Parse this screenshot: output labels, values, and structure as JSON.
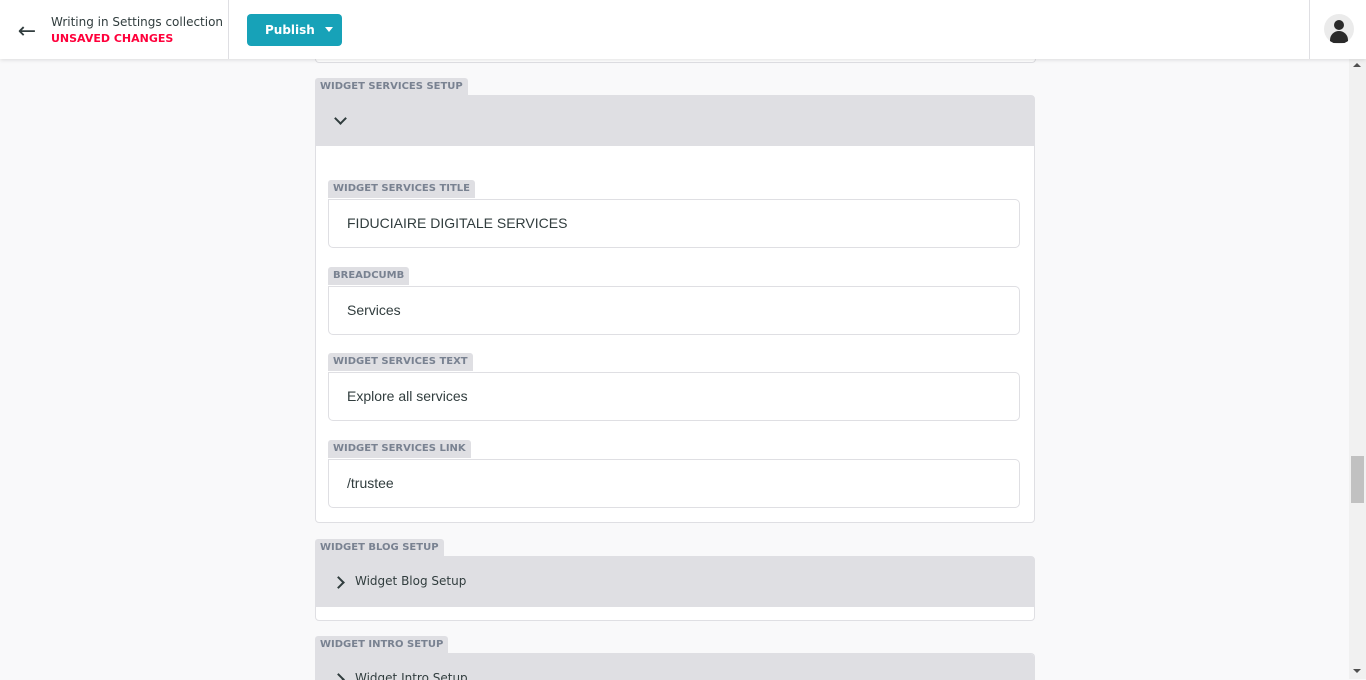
{
  "header": {
    "back_icon": "arrow-left-icon",
    "collection_title": "Writing in Settings collection",
    "status": "UNSAVED CHANGES",
    "publish_label": "Publish",
    "avatar_icon": "user-avatar-icon",
    "colors": {
      "accent": "#17a2b8",
      "unsaved": "#ff003b"
    }
  },
  "widget_services": {
    "label": "WIDGET SERVICES SETUP",
    "expanded": true,
    "fields": [
      {
        "label": "WIDGET SERVICES TITLE",
        "value": "FIDUCIAIRE DIGITALE SERVICES"
      },
      {
        "label": "BREADCUMB",
        "value": "Services"
      },
      {
        "label": "WIDGET SERVICES TEXT",
        "value": "Explore all services"
      },
      {
        "label": "WIDGET SERVICES LINK",
        "value": "/trustee"
      }
    ]
  },
  "widget_blog": {
    "label": "WIDGET BLOG SETUP",
    "summary": "Widget Blog Setup",
    "expanded": false
  },
  "widget_intro": {
    "label": "WIDGET INTRO SETUP",
    "summary": "Widget Intro Setup",
    "expanded": false
  }
}
